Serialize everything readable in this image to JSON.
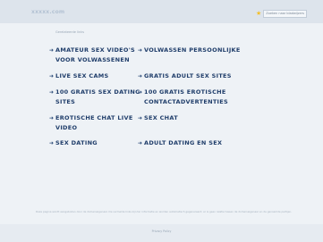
{
  "header": {
    "domain": "xxxxx.com",
    "bookmark_label": "Zoeken naar bladwijzers"
  },
  "main": {
    "related_label": "Gerelateerde links",
    "links": [
      {
        "label": "AMATEUR SEX VIDEO'S VOOR VOLWASSENEN"
      },
      {
        "label": "VOLWASSEN PERSOONLIJKE"
      },
      {
        "label": "LIVE SEX CAMS"
      },
      {
        "label": "GRATIS ADULT SEX SITES"
      },
      {
        "label": "100 GRATIS SEX DATING SITES"
      },
      {
        "label": "100 GRATIS EROTISCHE CONTACTADVERTENTIES"
      },
      {
        "label": "EROTISCHE CHAT LIVE VIDEO"
      },
      {
        "label": "SEX CHAT"
      },
      {
        "label": "SEX DATING"
      },
      {
        "label": "ADULT DATING EN SEX"
      }
    ]
  },
  "footer": {
    "disclaimer": "Deze pagina wordt aangeboden door de domeineigenaar. De vermelde links zijn ter informatie en worden automatisch gegenereerd; er is geen relatie tussen de domeineigenaar en de genoemde partijen.",
    "privacy_label": "Privacy Policy"
  },
  "colors": {
    "background": "#eef2f6",
    "header": "#dde4ec",
    "link": "#1f3d6a",
    "muted": "#98a6b5",
    "star": "#f3c02b"
  },
  "icons": {
    "bookmark": "star-icon",
    "link_marker": "arrow-right-icon"
  }
}
